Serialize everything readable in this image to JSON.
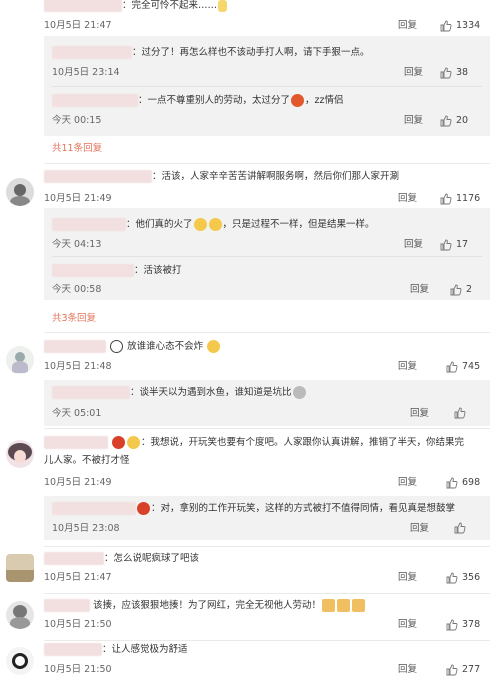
{
  "labels": {
    "reply": "回复"
  },
  "c1": {
    "text": "：完全可怜不起来……",
    "time": "10月5日 21:47",
    "likes": "1334"
  },
  "c1r1": {
    "text": "：过分了！再怎么样也不该动手打人啊，请下手狠一点。",
    "time": "10月5日 23:14",
    "likes": "38"
  },
  "c1r2": {
    "text": "：一点不尊重别人的劳动，太过分了",
    "text2": "zz情侣",
    "time": "今天 00:15",
    "likes": "20"
  },
  "c1more": "共11条回复",
  "c2": {
    "text": "：活该，人家辛辛苦苦讲解啊服务啊，然后你们那人家开涮",
    "time": "10月5日 21:49",
    "likes": "1176"
  },
  "c2r1": {
    "text": "：他们真的火了",
    "text2": "，只是过程不一样，但是结果一样。",
    "time": "今天 04:13",
    "likes": "17"
  },
  "c2r2": {
    "text": "：活该被打",
    "time": "今天 00:58",
    "likes": "2"
  },
  "c2more": "共3条回复",
  "c3": {
    "text": "放谁谁心态不会炸",
    "time": "10月5日 21:48",
    "likes": "745"
  },
  "c3r1": {
    "text": "：谈半天以为遇到水鱼，谁知道是坑比",
    "time": "今天 05:01"
  },
  "c4": {
    "text": "：我想说，开玩笑也要有个度吧。人家跟你认真讲解，推销了半天，你结果完",
    "text2": "儿人家。不被打才怪",
    "time": "10月5日 21:49",
    "likes": "698"
  },
  "c4r1": {
    "text": "：对，拿别的工作开玩笑，这样的方式被打不值得同情，看见真是想鼓掌",
    "time": "10月5日 23:08"
  },
  "c5": {
    "text": "：怎么说呢疯球了吧该",
    "time": "10月5日 21:47",
    "likes": "356"
  },
  "c6": {
    "text": "该揍，应该狠狠地揍！为了网红，完全无视他人劳动！",
    "time": "10月5日 21:50",
    "likes": "378"
  },
  "c7": {
    "text": "：让人感觉极为舒适",
    "time": "10月5日 21:50",
    "likes": "277"
  }
}
